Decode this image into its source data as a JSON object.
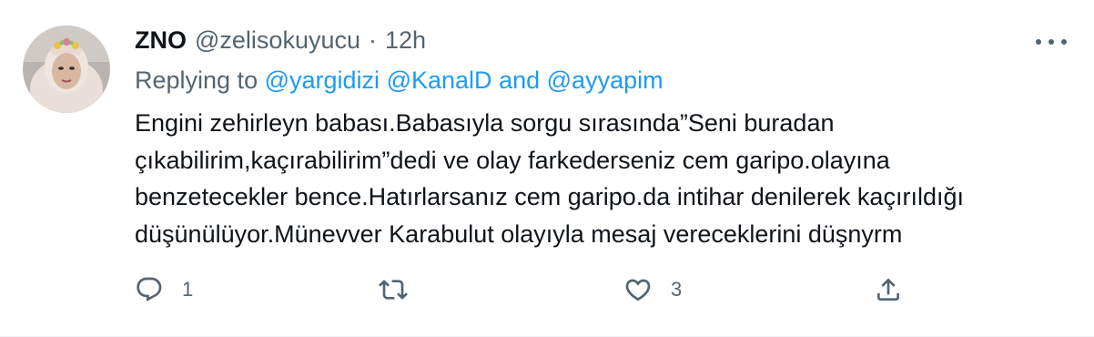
{
  "tweet": {
    "author": {
      "display_name": "ZNO",
      "handle": "@zelisokuyucu",
      "separator": "·",
      "time": "12h"
    },
    "replying": {
      "prefix": "Replying to",
      "mention1": "@yargidizi",
      "mention2": "@KanalD",
      "conjunction": "and",
      "mention3": "@ayyapim"
    },
    "text_lines": [
      "Engini zehirleyn babası.Babasıyla sorgu sırasında”Seni buradan",
      "çıkabilirim,kaçırabilirim”dedi ve olay farkederseniz cem garipo.olayına",
      "benzetecekler bence.Hatırlarsanız cem garipo.da intihar denilerek kaçırıldığı",
      "düşünülüyor.Münevver Karabulut olayıyla mesaj vereceklerini düşnyrm"
    ],
    "actions": {
      "reply_count": "1",
      "retweet_count": "",
      "like_count": "3"
    }
  },
  "colors": {
    "text": "#0f1419",
    "secondary": "#536471",
    "link": "#1d9bf0"
  },
  "icons": [
    "reply-icon",
    "retweet-icon",
    "like-icon",
    "share-icon",
    "more-icon"
  ]
}
